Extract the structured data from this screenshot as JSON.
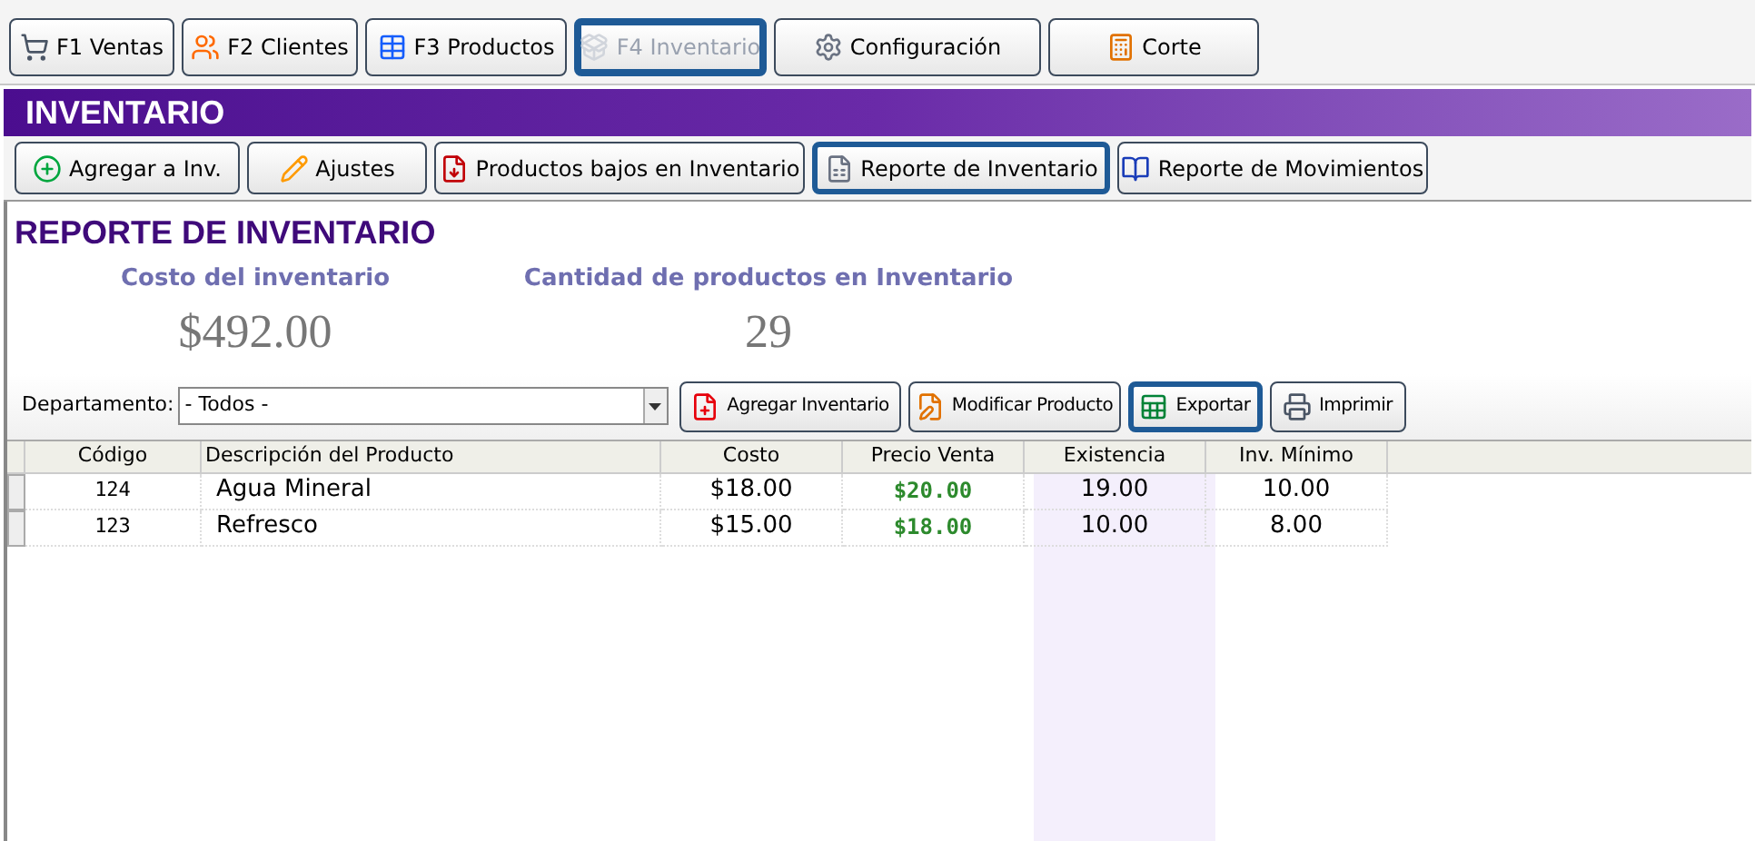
{
  "nav_tabs": [
    {
      "label": "F1 Ventas",
      "selected": false
    },
    {
      "label": "F2 Clientes",
      "selected": false
    },
    {
      "label": "F3 Productos",
      "selected": false
    },
    {
      "label": "F4 Inventario",
      "selected": true
    },
    {
      "label": "Configuración",
      "selected": false
    },
    {
      "label": "Corte",
      "selected": false
    }
  ],
  "section_title": "INVENTARIO",
  "actions": [
    {
      "label": "Agregar a Inv.",
      "selected": false
    },
    {
      "label": "Ajustes",
      "selected": false
    },
    {
      "label": "Productos bajos en Inventario",
      "selected": false
    },
    {
      "label": "Reporte de Inventario",
      "selected": true
    },
    {
      "label": "Reporte de Movimientos",
      "selected": false
    }
  ],
  "report": {
    "title": "REPORTE DE INVENTARIO",
    "metrics": [
      {
        "label": "Costo del inventario",
        "value": "$492.00"
      },
      {
        "label": "Cantidad de productos en Inventario",
        "value": "29"
      }
    ],
    "filter": {
      "label": "Departamento:",
      "value": "- Todos -"
    },
    "buttons": [
      {
        "label": "Agregar Inventario",
        "selected": false
      },
      {
        "label": "Modificar Producto",
        "selected": false
      },
      {
        "label": "Exportar",
        "selected": true
      },
      {
        "label": "Imprimir",
        "selected": false
      }
    ]
  },
  "table": {
    "columns": [
      "Código",
      "Descripción del Producto",
      "Costo",
      "Precio Venta",
      "Existencia",
      "Inv. Mínimo"
    ],
    "rows": [
      {
        "cells": [
          "124",
          "Agua Mineral",
          "$18.00",
          "$20.00",
          "19.00",
          "10.00"
        ]
      },
      {
        "cells": [
          "123",
          "Refresco",
          "$15.00",
          "$18.00",
          "10.00",
          "8.00"
        ]
      }
    ]
  }
}
